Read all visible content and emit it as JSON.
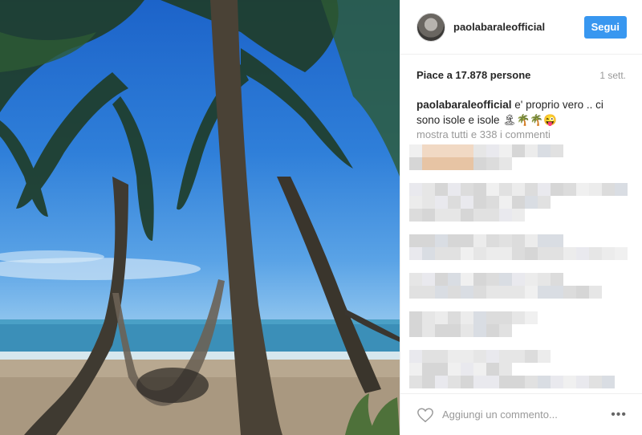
{
  "post": {
    "image_alt": "beach with palm trees and hammocks"
  },
  "header": {
    "username": "paolabaraleofficial",
    "follow_label": "Segui"
  },
  "stats": {
    "likes": "Piace a 17.878 persone",
    "time": "1 sett."
  },
  "caption": {
    "user": "paolabaraleofficial",
    "text": " e' proprio vero .. ci sono isole e isole 🏝🌴🌴😜"
  },
  "comments": {
    "view_all": "mostra tutti e 338 i commenti"
  },
  "comment_bar": {
    "placeholder": "Aggiungi un commento...",
    "more_label": "•••"
  },
  "colors": {
    "accent": "#3897f0",
    "muted": "#999999"
  },
  "icons": {
    "like": "heart-outline-icon",
    "options": "more-options-icon"
  }
}
